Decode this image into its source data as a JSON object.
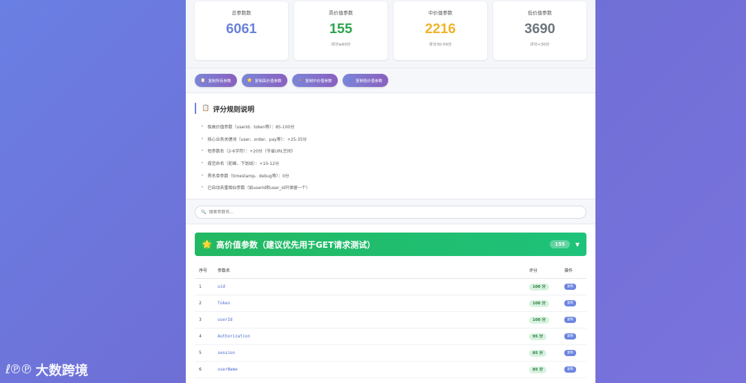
{
  "stats": [
    {
      "label": "总参数数",
      "value": "6061",
      "sub": "",
      "color": "#6a82d8"
    },
    {
      "label": "高价值参数",
      "value": "155",
      "sub": "评分≥60分",
      "color": "#2ea44f"
    },
    {
      "label": "中价值参数",
      "value": "2216",
      "sub": "评分30-59分",
      "color": "#f0b429"
    },
    {
      "label": "低价值参数",
      "value": "3690",
      "sub": "评分<30分",
      "color": "#6c757d"
    }
  ],
  "buttons": [
    {
      "icon": "📋",
      "label": "复制所有参数"
    },
    {
      "icon": "⭐",
      "label": "复制高价值参数"
    },
    {
      "icon": "🔸",
      "label": "复制中价值参数"
    },
    {
      "icon": "🔹",
      "label": "复制低价值参数"
    }
  ],
  "rules": {
    "icon": "📋",
    "title": "评分规则说明",
    "items": [
      "极高价值参数（userId、token等）：85-100分",
      "核心业务关键词（user、order、pay等）：+25-35分",
      "短参数名（2-6字符）：+20分（节省URL空间）",
      "规范命名（驼峰、下划线）：+10-12分",
      "黑名单参数（timestamp、debug等）：0分",
      "已自动去重相似参数（如userId和user_id只保留一个）"
    ]
  },
  "search": {
    "icon": "🔍",
    "placeholder": "搜索参数名..."
  },
  "section": {
    "icon": "🌟",
    "title": "高价值参数（建议优先用于GET请求测试）",
    "count": "155",
    "chevron": "▼",
    "columns": [
      "序号",
      "参数名",
      "评分",
      "操作"
    ],
    "rows": [
      {
        "idx": "1",
        "name": "uid",
        "score": "100 分",
        "action": "复制"
      },
      {
        "idx": "2",
        "name": "Token",
        "score": "100 分",
        "action": "复制"
      },
      {
        "idx": "3",
        "name": "userId",
        "score": "100 分",
        "action": "复制"
      },
      {
        "idx": "4",
        "name": "Authorization",
        "score": "95 分",
        "action": "复制"
      },
      {
        "idx": "5",
        "name": "session",
        "score": "85 分",
        "action": "复制"
      },
      {
        "idx": "6",
        "name": "userName",
        "score": "85 分",
        "action": "复制"
      }
    ]
  },
  "watermark": {
    "logo": "ℓ℗℗",
    "text": "大数跨境"
  }
}
